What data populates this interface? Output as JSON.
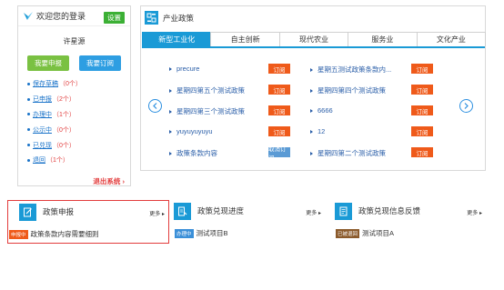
{
  "login": {
    "title": "欢迎您的登录",
    "settings_label": "设置",
    "username": "许星源",
    "apply_label": "我要申报",
    "subscribe_label": "我要订阅",
    "status_items": [
      {
        "label": "保存草稿",
        "count": "（0个）"
      },
      {
        "label": "已申报",
        "count": "（2个）"
      },
      {
        "label": "办理中",
        "count": "（1个）"
      },
      {
        "label": "公示中",
        "count": "（0个）"
      },
      {
        "label": "已兑现",
        "count": "（0个）"
      },
      {
        "label": "退回",
        "count": "（1个）"
      }
    ],
    "logout_label": "退出系统"
  },
  "policy": {
    "title": "产业政策",
    "tabs": [
      "新型工业化",
      "自主创新",
      "现代农业",
      "服务业",
      "文化产业"
    ],
    "active_tab": 0,
    "left_items": [
      {
        "title": "precure",
        "action": "订阅"
      },
      {
        "title": "星期四第五个测试政策",
        "action": "订阅"
      },
      {
        "title": "星期四第三个测试政策",
        "action": "订阅"
      },
      {
        "title": "yuyuyuyuyu",
        "action": "订阅"
      },
      {
        "title": "政策条款内容",
        "action": "取消订阅"
      }
    ],
    "right_items": [
      {
        "title": "星期五测试政策条款内...",
        "action": "订阅"
      },
      {
        "title": "星期四第四个测试政策",
        "action": "订阅"
      },
      {
        "title": "6666",
        "action": "订阅"
      },
      {
        "title": "12",
        "action": "订阅"
      },
      {
        "title": "星期四第二个测试政策",
        "action": "订阅"
      }
    ]
  },
  "cards": [
    {
      "title": "政策申报",
      "more": "更多",
      "badge": "申报中",
      "badge_color": "#ef5a1a",
      "item": "政策条款内容需要细则",
      "icon": "edit-document-icon"
    },
    {
      "title": "政策兑现进度",
      "more": "更多",
      "badge": "办理中",
      "badge_color": "#3a8fd8",
      "item": "测试项目B",
      "icon": "progress-document-icon"
    },
    {
      "title": "政策兑现信息反馈",
      "more": "更多",
      "badge": "已被退回",
      "badge_color": "#8b5a2b",
      "item": "测试项目A",
      "icon": "feedback-document-icon"
    }
  ],
  "colors": {
    "accent": "#1a9ad6",
    "subscribe_tag": "#ef5a1a",
    "cancel_tag": "#5b9bd5",
    "highlight_border": "#e23c3c",
    "green": "#3cb035"
  }
}
